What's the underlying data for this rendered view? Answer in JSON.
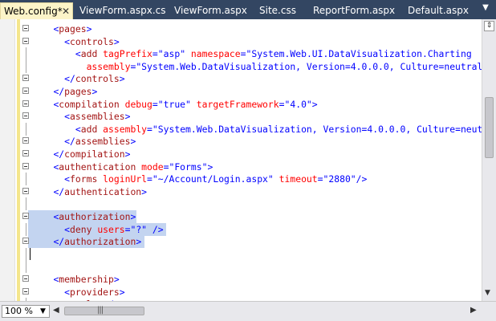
{
  "tabs": [
    {
      "label": "Web.config*",
      "active": true
    },
    {
      "label": "ViewForm.aspx.cs",
      "active": false
    },
    {
      "label": "ViewForm.aspx",
      "active": false
    },
    {
      "label": "Site.css",
      "active": false
    },
    {
      "label": "ReportForm.aspx",
      "active": false
    },
    {
      "label": "Default.aspx",
      "active": false
    }
  ],
  "tab_close_glyph": "✕",
  "tab_menu_glyph": "▼",
  "colors": {
    "tab_strip": "#334662",
    "active_tab": "#fcf4c8",
    "xml_bracket": "#0000ff",
    "xml_tag": "#a31515",
    "xml_attr": "#ff0000",
    "xml_value": "#0000ff",
    "selection": "#c3d4f0"
  },
  "code_lines": [
    [
      {
        "t": "    ",
        "c": "p"
      },
      {
        "t": "<",
        "c": "b"
      },
      {
        "t": "pages",
        "c": "g"
      },
      {
        "t": ">",
        "c": "b"
      }
    ],
    [
      {
        "t": "      ",
        "c": "p"
      },
      {
        "t": "<",
        "c": "b"
      },
      {
        "t": "controls",
        "c": "g"
      },
      {
        "t": ">",
        "c": "b"
      }
    ],
    [
      {
        "t": "        ",
        "c": "p"
      },
      {
        "t": "<",
        "c": "b"
      },
      {
        "t": "add",
        "c": "g"
      },
      {
        "t": " ",
        "c": "p"
      },
      {
        "t": "tagPrefix",
        "c": "a"
      },
      {
        "t": "=",
        "c": "b"
      },
      {
        "t": "\"asp\"",
        "c": "v"
      },
      {
        "t": " ",
        "c": "p"
      },
      {
        "t": "namespace",
        "c": "a"
      },
      {
        "t": "=",
        "c": "b"
      },
      {
        "t": "\"System.Web.UI.DataVisualization.Charting",
        "c": "v"
      }
    ],
    [
      {
        "t": "          ",
        "c": "p"
      },
      {
        "t": "assembly",
        "c": "a"
      },
      {
        "t": "=",
        "c": "b"
      },
      {
        "t": "\"System.Web.DataVisualization, Version=4.0.0.0, Culture=neutral,",
        "c": "v"
      }
    ],
    [
      {
        "t": "      ",
        "c": "p"
      },
      {
        "t": "</",
        "c": "b"
      },
      {
        "t": "controls",
        "c": "g"
      },
      {
        "t": ">",
        "c": "b"
      }
    ],
    [
      {
        "t": "    ",
        "c": "p"
      },
      {
        "t": "</",
        "c": "b"
      },
      {
        "t": "pages",
        "c": "g"
      },
      {
        "t": ">",
        "c": "b"
      }
    ],
    [
      {
        "t": "    ",
        "c": "p"
      },
      {
        "t": "<",
        "c": "b"
      },
      {
        "t": "compilation",
        "c": "g"
      },
      {
        "t": " ",
        "c": "p"
      },
      {
        "t": "debug",
        "c": "a"
      },
      {
        "t": "=",
        "c": "b"
      },
      {
        "t": "\"true\"",
        "c": "v"
      },
      {
        "t": " ",
        "c": "p"
      },
      {
        "t": "targetFramework",
        "c": "a"
      },
      {
        "t": "=",
        "c": "b"
      },
      {
        "t": "\"4.0\"",
        "c": "v"
      },
      {
        "t": ">",
        "c": "b"
      }
    ],
    [
      {
        "t": "      ",
        "c": "p"
      },
      {
        "t": "<",
        "c": "b"
      },
      {
        "t": "assemblies",
        "c": "g"
      },
      {
        "t": ">",
        "c": "b"
      }
    ],
    [
      {
        "t": "        ",
        "c": "p"
      },
      {
        "t": "<",
        "c": "b"
      },
      {
        "t": "add",
        "c": "g"
      },
      {
        "t": " ",
        "c": "p"
      },
      {
        "t": "assembly",
        "c": "a"
      },
      {
        "t": "=",
        "c": "b"
      },
      {
        "t": "\"System.Web.DataVisualization, Version=4.0.0.0, Culture=neutr",
        "c": "v"
      }
    ],
    [
      {
        "t": "      ",
        "c": "p"
      },
      {
        "t": "</",
        "c": "b"
      },
      {
        "t": "assemblies",
        "c": "g"
      },
      {
        "t": ">",
        "c": "b"
      }
    ],
    [
      {
        "t": "    ",
        "c": "p"
      },
      {
        "t": "</",
        "c": "b"
      },
      {
        "t": "compilation",
        "c": "g"
      },
      {
        "t": ">",
        "c": "b"
      }
    ],
    [
      {
        "t": "    ",
        "c": "p"
      },
      {
        "t": "<",
        "c": "b"
      },
      {
        "t": "authentication",
        "c": "g"
      },
      {
        "t": " ",
        "c": "p"
      },
      {
        "t": "mode",
        "c": "a"
      },
      {
        "t": "=",
        "c": "b"
      },
      {
        "t": "\"Forms\"",
        "c": "v"
      },
      {
        "t": ">",
        "c": "b"
      }
    ],
    [
      {
        "t": "      ",
        "c": "p"
      },
      {
        "t": "<",
        "c": "b"
      },
      {
        "t": "forms",
        "c": "g"
      },
      {
        "t": " ",
        "c": "p"
      },
      {
        "t": "loginUrl",
        "c": "a"
      },
      {
        "t": "=",
        "c": "b"
      },
      {
        "t": "\"~/Account/Login.aspx\"",
        "c": "v"
      },
      {
        "t": " ",
        "c": "p"
      },
      {
        "t": "timeout",
        "c": "a"
      },
      {
        "t": "=",
        "c": "b"
      },
      {
        "t": "\"2880\"",
        "c": "v"
      },
      {
        "t": "/>",
        "c": "b"
      }
    ],
    [
      {
        "t": "    ",
        "c": "p"
      },
      {
        "t": "</",
        "c": "b"
      },
      {
        "t": "authentication",
        "c": "g"
      },
      {
        "t": ">",
        "c": "b"
      }
    ],
    [],
    [
      {
        "t": "    ",
        "c": "p"
      },
      {
        "t": "<",
        "c": "b"
      },
      {
        "t": "authorization",
        "c": "g"
      },
      {
        "t": ">",
        "c": "b"
      }
    ],
    [
      {
        "t": "      ",
        "c": "p"
      },
      {
        "t": "<",
        "c": "b"
      },
      {
        "t": "deny",
        "c": "g"
      },
      {
        "t": " ",
        "c": "p"
      },
      {
        "t": "users",
        "c": "a"
      },
      {
        "t": "=",
        "c": "b"
      },
      {
        "t": "\"?\"",
        "c": "v"
      },
      {
        "t": " ",
        "c": "p"
      },
      {
        "t": "/>",
        "c": "b"
      }
    ],
    [
      {
        "t": "    ",
        "c": "p"
      },
      {
        "t": "</",
        "c": "b"
      },
      {
        "t": "authorization",
        "c": "g"
      },
      {
        "t": ">",
        "c": "b"
      }
    ],
    [],
    [],
    [
      {
        "t": "    ",
        "c": "p"
      },
      {
        "t": "<",
        "c": "b"
      },
      {
        "t": "membership",
        "c": "g"
      },
      {
        "t": ">",
        "c": "b"
      }
    ],
    [
      {
        "t": "      ",
        "c": "p"
      },
      {
        "t": "<",
        "c": "b"
      },
      {
        "t": "providers",
        "c": "g"
      },
      {
        "t": ">",
        "c": "b"
      }
    ],
    [
      {
        "t": "        ",
        "c": "p"
      },
      {
        "t": "<",
        "c": "b"
      },
      {
        "t": "clear",
        "c": "g"
      },
      {
        "t": "/>",
        "c": "b"
      }
    ],
    [
      {
        "t": "        ",
        "c": "p"
      },
      {
        "t": "<",
        "c": "b"
      },
      {
        "t": "add",
        "c": "g"
      },
      {
        "t": " ",
        "c": "p"
      },
      {
        "t": "name",
        "c": "a"
      },
      {
        "t": "=",
        "c": "b"
      },
      {
        "t": "\"AspNetSqlMembershipProvider\"",
        "c": "v"
      },
      {
        "t": " ",
        "c": "p"
      },
      {
        "t": "type",
        "c": "a"
      },
      {
        "t": "=",
        "c": "b"
      },
      {
        "t": "\"System.Web.Security.SqlMember",
        "c": "v"
      }
    ]
  ],
  "zoom_level": "100 %",
  "scroll_grip": "|||"
}
